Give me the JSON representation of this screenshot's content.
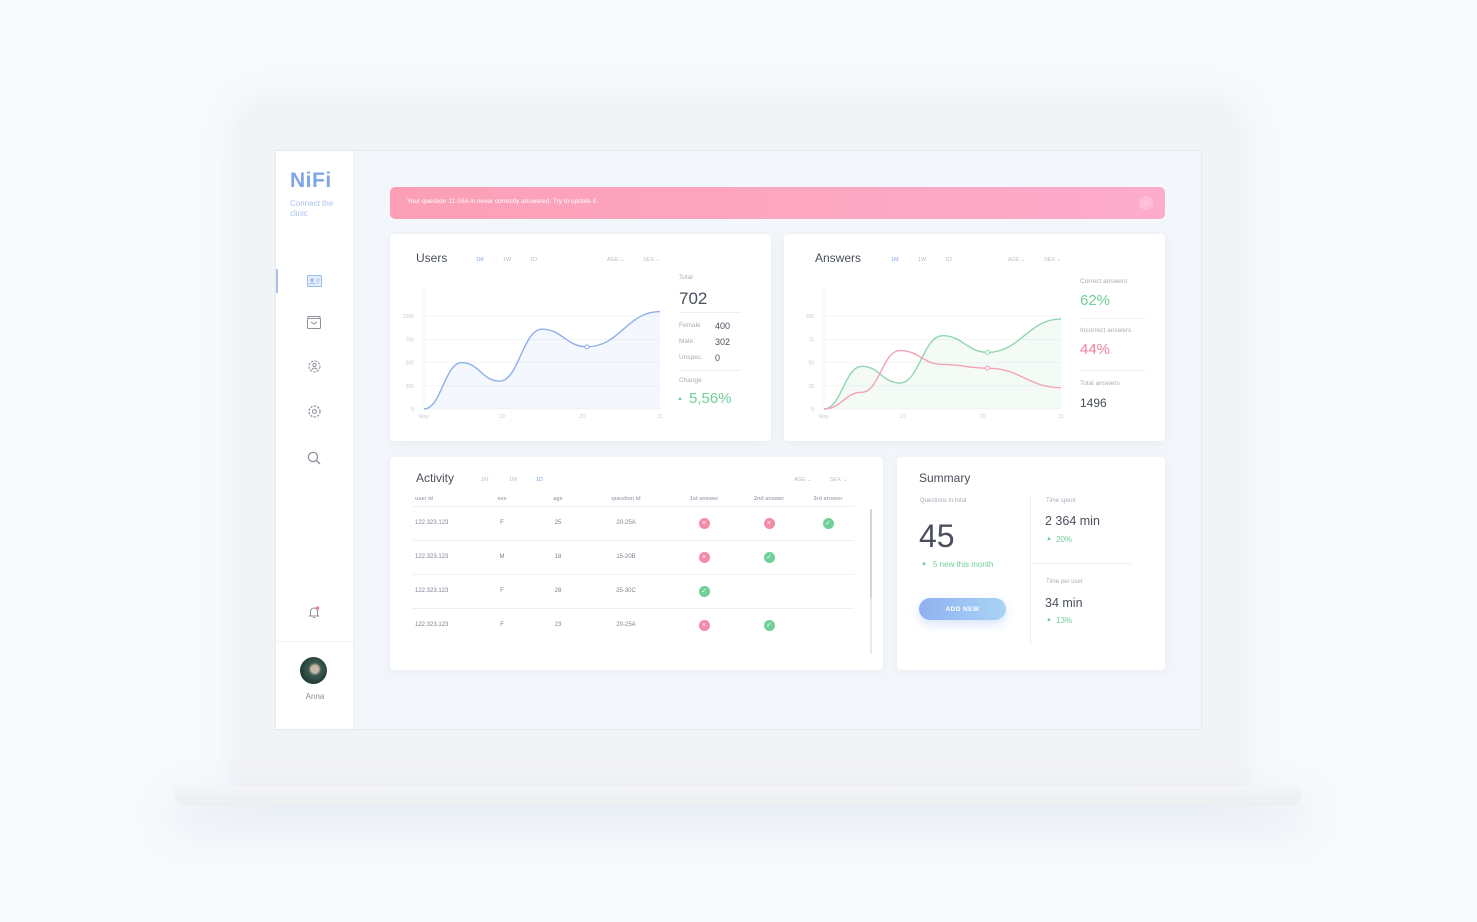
{
  "app": {
    "logo": "NiFi",
    "tagline": "Connect the clinic"
  },
  "sidebar": {
    "items": [
      {
        "name": "profile-card-icon",
        "active": true
      },
      {
        "name": "archive-icon",
        "active": false
      },
      {
        "name": "patients-icon",
        "active": false
      },
      {
        "name": "gear-icon",
        "active": false
      },
      {
        "name": "search-icon",
        "active": false
      }
    ],
    "notification_icon": "bell-icon",
    "notification_badge_color": "#f07e9e",
    "user": {
      "name": "Anna"
    }
  },
  "alert": {
    "message": "Your question 11-16A is never correctly answered. Try to update it.",
    "close_icon": "›"
  },
  "users": {
    "title": "Users",
    "tabs": [
      "1M",
      "1W",
      "1D"
    ],
    "active_tab": "1M",
    "filters": [
      "AGE ⌄",
      "SEX ⌄"
    ],
    "total_label": "Total",
    "total": "702",
    "breakdown": [
      {
        "label": "Female",
        "value": "400"
      },
      {
        "label": "Male",
        "value": "302"
      },
      {
        "label": "Unspec.",
        "value": "0"
      }
    ],
    "change_label": "Change",
    "change": "5,56%",
    "change_arrow": "▲"
  },
  "answers": {
    "title": "Answers",
    "tabs": [
      "1M",
      "1W",
      "1D"
    ],
    "active_tab": "1M",
    "filters": [
      "AGE ⌄",
      "SEX ⌄"
    ],
    "correct_label": "Correct answers",
    "correct": "62%",
    "incorrect_label": "Incorrect answers",
    "incorrect": "44%",
    "total_label": "Total answers",
    "total": "1496"
  },
  "activity": {
    "title": "Activity",
    "tabs": [
      "1M",
      "1W",
      "1D"
    ],
    "active_tab": "1D",
    "filters": [
      "AGE ⌄",
      "SEX ⌄"
    ],
    "columns": [
      "user id",
      "sex",
      "age",
      "question id",
      "1st answer",
      "2nd answer",
      "3rd answer"
    ],
    "rows": [
      {
        "user_id": "122.323.123",
        "sex": "F",
        "age": "25",
        "question_id": "20-25A",
        "answers": [
          "incorrect",
          "incorrect",
          "correct"
        ]
      },
      {
        "user_id": "122.323.123",
        "sex": "M",
        "age": "18",
        "question_id": "15-20B",
        "answers": [
          "incorrect",
          "correct",
          ""
        ]
      },
      {
        "user_id": "122.323.123",
        "sex": "F",
        "age": "28",
        "question_id": "25-30C",
        "answers": [
          "correct",
          "",
          ""
        ]
      },
      {
        "user_id": "122.323.123",
        "sex": "F",
        "age": "23",
        "question_id": "20-25A",
        "answers": [
          "incorrect",
          "correct",
          ""
        ]
      }
    ]
  },
  "summary": {
    "title": "Summary",
    "questions_label": "Questions in total",
    "questions_total": "45",
    "questions_change": "5 new this month",
    "add_button": "ADD NEW",
    "time_spent_label": "Time spent",
    "time_spent": "2 364 min",
    "time_spent_change": "20%",
    "time_per_user_label": "Time per user",
    "time_per_user": "34 min",
    "time_per_user_change": "13%",
    "arrow": "▲"
  },
  "colors": {
    "accent": "#7ea4ea",
    "correct": "#6fcf97",
    "incorrect": "#f07e9e",
    "alert": "#fca4bf"
  },
  "chart_data": [
    {
      "type": "area",
      "title": "Users",
      "x": [
        "May 1",
        "May 5",
        "May 9",
        "May 14",
        "May 21",
        "May 31"
      ],
      "xticks": [
        "May",
        "10",
        "20",
        "31"
      ],
      "yticks": [
        "0",
        "250",
        "500",
        "750",
        "1000"
      ],
      "ylim": [
        0,
        1250
      ],
      "series": [
        {
          "name": "Users",
          "color": "#8fb1e8",
          "values": [
            0,
            500,
            300,
            860,
            670,
            1050
          ]
        }
      ],
      "highlight_index": 4,
      "grid": true
    },
    {
      "type": "area",
      "title": "Answers",
      "x": [
        "May 1",
        "May 5",
        "May 9",
        "May 14",
        "May 21",
        "May 31"
      ],
      "xticks": [
        "May",
        "10",
        "20",
        "31"
      ],
      "yticks": [
        "0",
        "25",
        "50",
        "75",
        "100"
      ],
      "ylim": [
        0,
        125
      ],
      "series": [
        {
          "name": "Correct answers",
          "color": "#8fd6ad",
          "values": [
            0,
            46,
            28,
            79,
            61,
            97
          ]
        },
        {
          "name": "Incorrect answers",
          "color": "#f2a2b8",
          "values": [
            0,
            18,
            63,
            48,
            44,
            23
          ]
        }
      ],
      "highlight_index": 4,
      "grid": true
    }
  ]
}
